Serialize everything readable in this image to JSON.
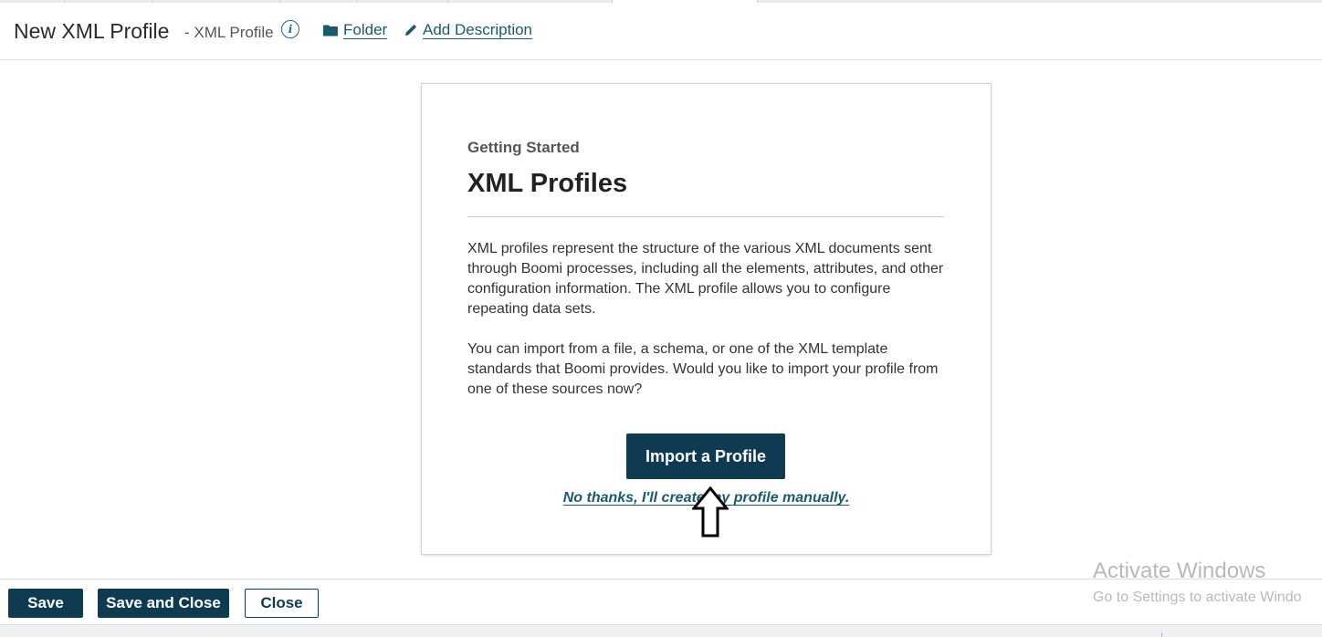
{
  "header": {
    "title": "New XML Profile",
    "subtitle": "- XML Profile",
    "info_icon": "info-icon",
    "folder_link": "Folder",
    "description_link": "Add Description"
  },
  "card": {
    "eyebrow": "Getting Started",
    "heading": "XML Profiles",
    "paragraph1": "XML profiles represent the structure of the various XML documents sent through Boomi processes, including all the elements, attributes, and other configuration information. The XML profile allows you to configure repeating data sets.",
    "paragraph2": "You can import from a file, a schema, or one of the XML template standards that Boomi provides. Would you like to import your profile from one of these sources now?",
    "import_button": "Import a Profile",
    "manual_link": "No thanks, I'll create my profile manually."
  },
  "footer": {
    "save_label": "Save",
    "save_close_label": "Save and Close",
    "close_label": "Close"
  },
  "watermark": {
    "line1": "Activate Windows",
    "line2": "Go to Settings to activate Windo"
  },
  "colors": {
    "primary": "#0e3b52",
    "link": "#1a5a6e"
  }
}
